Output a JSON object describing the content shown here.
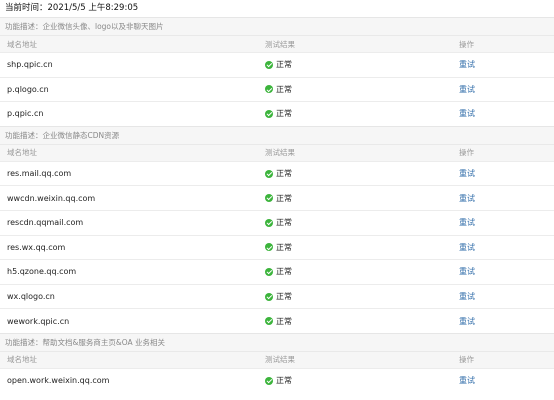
{
  "current_time": "当前时间：2021/5/5 上午8:29:05",
  "columns": {
    "domain": "域名地址",
    "result": "测试结果",
    "action": "操作"
  },
  "sections": [
    {
      "description": "功能描述：企业微信头像、logo以及非聊天图片",
      "rows": [
        {
          "domain": "shp.qpic.cn",
          "status": "正常",
          "action": "重试"
        },
        {
          "domain": "p.qlogo.cn",
          "status": "正常",
          "action": "重试"
        },
        {
          "domain": "p.qpic.cn",
          "status": "正常",
          "action": "重试"
        }
      ]
    },
    {
      "description": "功能描述：企业微信静态CDN资源",
      "rows": [
        {
          "domain": "res.mail.qq.com",
          "status": "正常",
          "action": "重试"
        },
        {
          "domain": "wwcdn.weixin.qq.com",
          "status": "正常",
          "action": "重试"
        },
        {
          "domain": "rescdn.qqmail.com",
          "status": "正常",
          "action": "重试"
        },
        {
          "domain": "res.wx.qq.com",
          "status": "正常",
          "action": "重试"
        },
        {
          "domain": "h5.qzone.qq.com",
          "status": "正常",
          "action": "重试"
        },
        {
          "domain": "wx.qlogo.cn",
          "status": "正常",
          "action": "重试"
        },
        {
          "domain": "wework.qpic.cn",
          "status": "正常",
          "action": "重试"
        }
      ]
    },
    {
      "description": "功能描述：帮助文档&服务商主页&OA 业务相关",
      "rows": [
        {
          "domain": "open.work.weixin.qq.com",
          "status": "正常",
          "action": "重试"
        }
      ]
    }
  ],
  "colors": {
    "ok": "#3cb43c",
    "link": "#2e6ba8",
    "section_bg": "#f6f6f6"
  },
  "icons": {
    "status_ok": "check-circle-icon"
  }
}
